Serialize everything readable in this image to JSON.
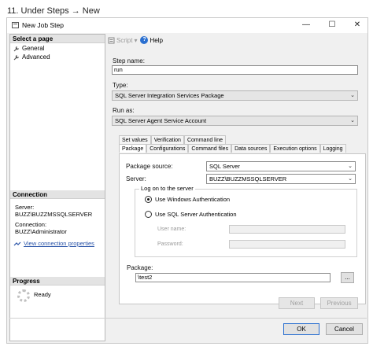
{
  "caption": "11. Under Steps → New",
  "window": {
    "title": "New Job Step",
    "minimize": "—",
    "maximize": "☐",
    "close": "✕"
  },
  "left": {
    "select_page_header": "Select a page",
    "pages": [
      {
        "label": "General",
        "icon": "wrench-icon"
      },
      {
        "label": "Advanced",
        "icon": "wrench-icon"
      }
    ],
    "connection_header": "Connection",
    "server_label": "Server:",
    "server_value": "BUZZ\\BUZZMSSQLSERVER",
    "connection_label": "Connection:",
    "connection_value": "BUZZ\\Administrator",
    "view_props_link": "View connection properties",
    "progress_header": "Progress",
    "progress_status": "Ready"
  },
  "toolbar": {
    "script_label": "Script",
    "help_label": "Help"
  },
  "form": {
    "step_name_label": "Step name:",
    "step_name_value": "run",
    "type_label": "Type:",
    "type_value": "SQL Server Integration Services Package",
    "run_as_label": "Run as:",
    "run_as_value": "SQL Server Agent Service Account"
  },
  "tabs_top": [
    "Set values",
    "Verification",
    "Command line"
  ],
  "tabs_bottom": [
    "Package",
    "Configurations",
    "Command files",
    "Data sources",
    "Execution options",
    "Logging"
  ],
  "package_tab": {
    "source_label": "Package source:",
    "source_value": "SQL Server",
    "server_label": "Server:",
    "server_value": "BUZZ\\BUZZMSSQLSERVER",
    "logon_legend": "Log on to the server",
    "windows_auth": "Use Windows Authentication",
    "sql_auth": "Use SQL Server Authentication",
    "username_label": "User name:",
    "password_label": "Password:",
    "package_label": "Package:",
    "package_value": "\\test2",
    "browse_button": "..."
  },
  "buttons": {
    "next": "Next",
    "previous": "Previous",
    "ok": "OK",
    "cancel": "Cancel"
  }
}
